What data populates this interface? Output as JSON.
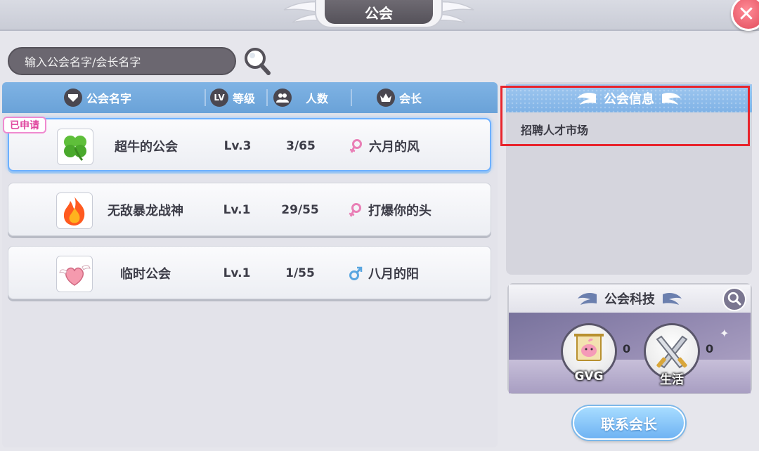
{
  "window": {
    "title": "公会",
    "close_label": "✕"
  },
  "search": {
    "placeholder": "输入公会名字/会长名字"
  },
  "table": {
    "columns": {
      "name": "公会名字",
      "level": "等级",
      "level_icon": "LV",
      "members": "人数",
      "leader": "会长"
    },
    "applied_badge": "已申请",
    "rows": [
      {
        "name": "超牛的公会",
        "level": "Lv.3",
        "members": "3/65",
        "leader": "六月的风",
        "leader_gender": "female",
        "icon": "clover-icon"
      },
      {
        "name": "无敌暴龙战神",
        "level": "Lv.1",
        "members": "29/55",
        "leader": "打爆你的头",
        "leader_gender": "female",
        "icon": "fire-icon"
      },
      {
        "name": "临时公会",
        "level": "Lv.1",
        "members": "1/55",
        "leader": "八月的阳",
        "leader_gender": "male",
        "icon": "winged-heart-icon"
      }
    ]
  },
  "info": {
    "title": "公会信息",
    "content": "招聘人才市场"
  },
  "tech": {
    "title": "公会科技",
    "items": [
      {
        "label": "GVG",
        "count": "0",
        "icon": "guild-banner-icon"
      },
      {
        "label": "生活",
        "count": "0",
        "icon": "crossed-swords-icon"
      }
    ]
  },
  "contact_button": "联系会长",
  "colors": {
    "header_blue": "#7fb3e4",
    "selected_border": "#6db0ff",
    "applied_badge": "#e0479f",
    "highlight_box": "#e8242c",
    "female": "#e97fb6",
    "male": "#5aa6e0"
  }
}
